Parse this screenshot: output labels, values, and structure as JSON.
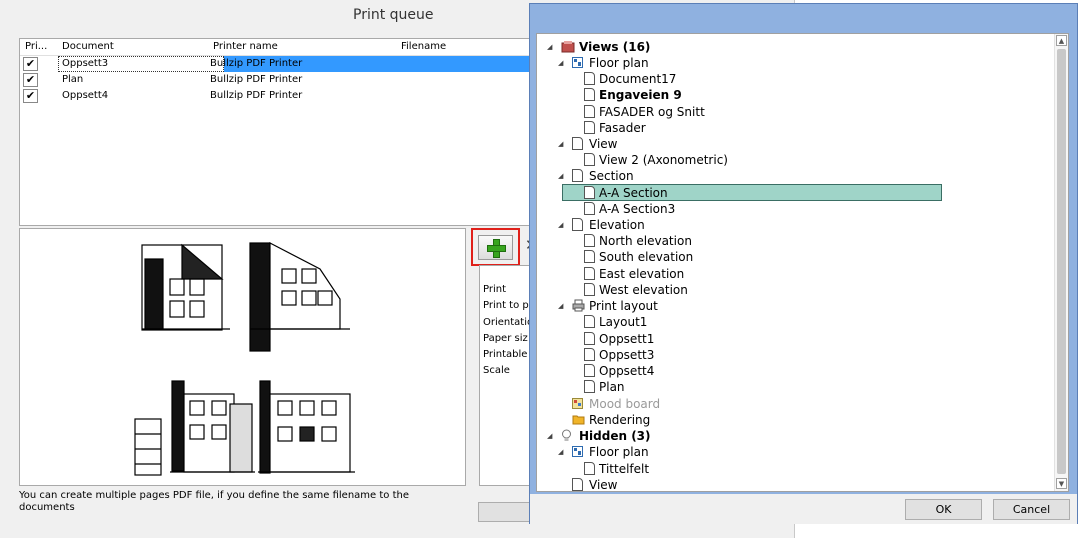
{
  "print_queue": {
    "title": "Print queue",
    "columns": [
      "Pri...",
      "Document",
      "Printer name",
      "Filename"
    ],
    "rows": [
      {
        "document": "Oppsett3",
        "printer": "Bullzip PDF Printer",
        "checked": true
      },
      {
        "document": "Plan",
        "printer": "Bullzip PDF Printer",
        "checked": true
      },
      {
        "document": "Oppsett4",
        "printer": "Bullzip PDF Printer",
        "checked": true
      }
    ],
    "properties": [
      "Print",
      "Print to p",
      "Orientatio",
      "Paper siz",
      "Printable",
      "Scale"
    ],
    "note": "You can create multiple pages PDF file, if you define the same filename to the documents"
  },
  "tree": {
    "views": {
      "label": "Views (16)"
    },
    "floor_plan": {
      "label": "Floor plan"
    },
    "floor_plan_items": [
      "Document17",
      "Engaveien 9",
      "FASADER og Snitt",
      "Fasader"
    ],
    "view": {
      "label": "View"
    },
    "view_items": [
      "View 2 (Axonometric)"
    ],
    "section": {
      "label": "Section"
    },
    "section_items": [
      "A-A Section",
      "A-A Section3"
    ],
    "elevation": {
      "label": "Elevation"
    },
    "elevation_items": [
      "North elevation",
      "South elevation",
      "East elevation",
      "West elevation"
    ],
    "print_layout": {
      "label": "Print layout"
    },
    "print_layout_items": [
      "Layout1",
      "Oppsett1",
      "Oppsett3",
      "Oppsett4",
      "Plan"
    ],
    "mood_board": {
      "label": "Mood board"
    },
    "rendering": {
      "label": "Rendering"
    },
    "hidden": {
      "label": "Hidden (3)"
    },
    "hidden_floor_plan": {
      "label": "Floor plan"
    },
    "hidden_floor_plan_items": [
      "Tittelfelt"
    ],
    "hidden_view": {
      "label": "View"
    }
  },
  "dialog": {
    "ok_label": "OK",
    "cancel_label": "Cancel"
  },
  "colors": {
    "selection": "#3399ff",
    "tree_highlight": "#9fd4c8",
    "add_frame": "#e0201a",
    "window_frame": "#8fb1e0"
  }
}
